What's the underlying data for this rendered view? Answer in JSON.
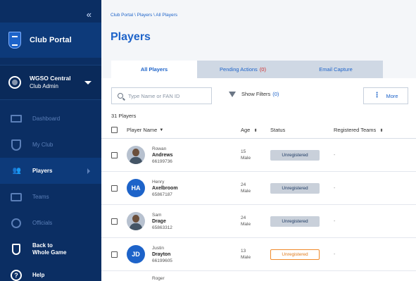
{
  "sidebar": {
    "collapse_glyph": "«",
    "brand": "Club Portal",
    "club": {
      "name": "WGSO Central",
      "role": "Club Admin"
    },
    "items": [
      {
        "label": "Dashboard",
        "icon": "monitor-icon"
      },
      {
        "label": "My Club",
        "icon": "shield-icon"
      },
      {
        "label": "Players",
        "icon": "players-icon"
      },
      {
        "label": "Teams",
        "icon": "shirt-icon"
      },
      {
        "label": "Officials",
        "icon": "whistle-icon"
      },
      {
        "label_line1": "Back to",
        "label_line2": "Whole Game",
        "icon": "crest-icon"
      },
      {
        "label": "Help",
        "icon": "help-icon",
        "glyph": "?"
      }
    ]
  },
  "header": {
    "breadcrumb": "Club Portal \\ Players \\ All Players",
    "title": "Players"
  },
  "tabs": [
    {
      "label": "All Players"
    },
    {
      "label": "Pending Actions",
      "count": "(0)"
    },
    {
      "label": "Email Capture"
    }
  ],
  "toolbar": {
    "search_placeholder": "Type Name or FAN ID",
    "filters_label": "Show Filters",
    "filters_count": "(0)",
    "more_label": "More",
    "more_glyph": "⋮"
  },
  "list": {
    "count": "31 Players",
    "columns": {
      "name": "Player Name",
      "age": "Age",
      "status": "Status",
      "teams": "Registered Teams"
    },
    "sort_glyph": "▼",
    "sort_both_glyph": "⬍",
    "rows": [
      {
        "first": "Rowan",
        "last": "Andrews",
        "fan": "66199736",
        "age": "15",
        "gender": "Male",
        "status": "Unregistered",
        "teams": "-",
        "avatar": "photo"
      },
      {
        "first": "Henry",
        "last": "Axelbroom",
        "fan": "65867187",
        "age": "24",
        "gender": "Male",
        "status": "Unregistered",
        "teams": "-",
        "avatar": "initials",
        "initials": "HA"
      },
      {
        "first": "Sam",
        "last": "Drage",
        "fan": "65863312",
        "age": "24",
        "gender": "Male",
        "status": "Unregistered",
        "teams": "-",
        "avatar": "photo"
      },
      {
        "first": "Justin",
        "last": "Drayton",
        "fan": "66199605",
        "age": "13",
        "gender": "Male",
        "status": "Unregistered",
        "teams": "-",
        "avatar": "initials",
        "initials": "JD",
        "warn": true
      },
      {
        "first": "Roger"
      }
    ]
  }
}
